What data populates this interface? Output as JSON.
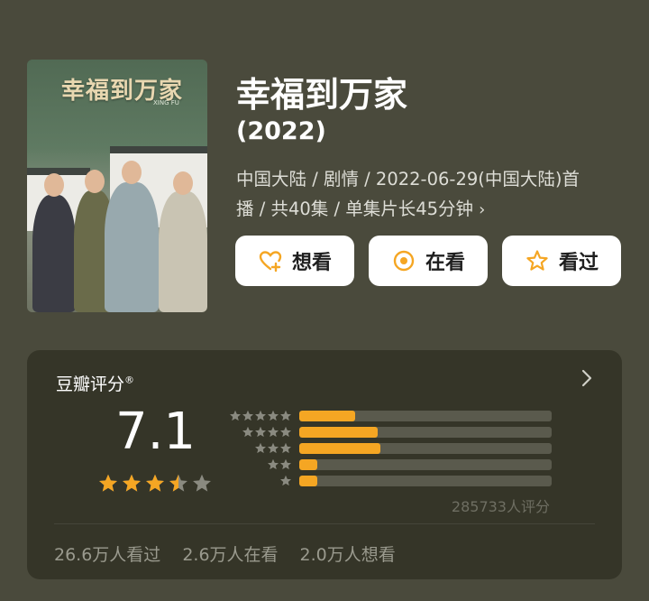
{
  "movie": {
    "title": "幸福到万家",
    "year": "(2022)",
    "meta_line1": "中国大陆 / 剧情 / 2022-06-29(中国大陆)首",
    "meta_line2": "播 / 共40集 / 单集片长45分钟"
  },
  "poster": {
    "title_text": "幸福到万家",
    "subtitle": "XING FU",
    "icon": "poster-image"
  },
  "actions": {
    "want_label": "想看",
    "watching_label": "在看",
    "watched_label": "看过"
  },
  "rating": {
    "heading": "豆瓣评分",
    "registered_mark": "®",
    "score": "7.1",
    "stars_value": 3.5,
    "stars_max": 5,
    "distribution": [
      {
        "stars": 5,
        "percent": 22
      },
      {
        "stars": 4,
        "percent": 31
      },
      {
        "stars": 3,
        "percent": 32
      },
      {
        "stars": 2,
        "percent": 7
      },
      {
        "stars": 1,
        "percent": 7
      }
    ],
    "count_text": "285733人评分"
  },
  "stats": {
    "watched": "26.6万人看过",
    "watching": "2.6万人在看",
    "want": "2.0万人想看"
  },
  "colors": {
    "background": "#4a4a3c",
    "card": "#353528",
    "accent": "#f5a623"
  }
}
